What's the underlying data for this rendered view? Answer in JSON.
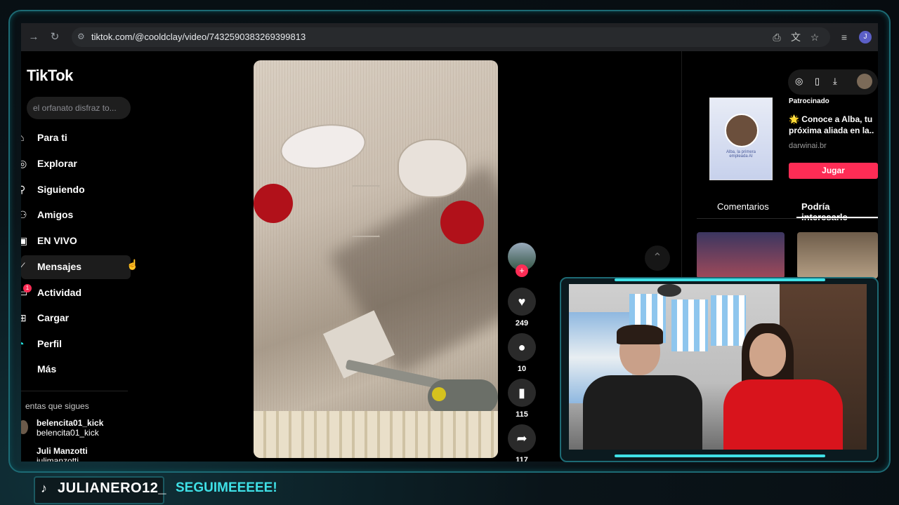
{
  "browser": {
    "url": "tiktok.com/@cooldclay/video/7432590383269399813",
    "profile_initial": "J"
  },
  "tiktok": {
    "logo": "TikTok",
    "search_placeholder": "el orfanato disfraz to...",
    "nav": [
      {
        "label": "Para ti",
        "icon": "home-icon"
      },
      {
        "label": "Explorar",
        "icon": "compass-icon"
      },
      {
        "label": "Siguiendo",
        "icon": "following-icon"
      },
      {
        "label": "Amigos",
        "icon": "friends-icon"
      },
      {
        "label": "EN VIVO",
        "icon": "live-icon"
      },
      {
        "label": "Mensajes",
        "icon": "messages-icon"
      },
      {
        "label": "Actividad",
        "icon": "activity-icon"
      },
      {
        "label": "Cargar",
        "icon": "upload-icon"
      },
      {
        "label": "Perfil",
        "icon": "profile-icon"
      },
      {
        "label": "Más",
        "icon": "more-icon"
      }
    ],
    "activity_badge": "1",
    "following_section_label": "entas que sigues",
    "following_accounts": [
      {
        "name": "belencita01_kick",
        "handle": "belencita01_kick"
      },
      {
        "name": "Juli Manzotti",
        "handle": "julimanzotti"
      }
    ]
  },
  "actions": {
    "likes": "249",
    "comments": "10",
    "saves": "115",
    "shares": "117"
  },
  "sidebar_right": {
    "sponsored_label": "Patrocinado",
    "ad_title": "🌟 Conoce a Alba, tu próxima aliada en la..",
    "ad_domain": "darwinai.br",
    "ad_cta": "Jugar",
    "ad_image_caption": "Alba, la primera empleada AI",
    "tabs": [
      "Comentarios",
      "Podría interesarle"
    ]
  },
  "overlay": {
    "channel_name": "JULIANERO12_",
    "slogan": "SEGUIMEEEEE!"
  },
  "colors": {
    "accent": "#fe2c55",
    "overlay_cyan": "#3fe0e6"
  }
}
